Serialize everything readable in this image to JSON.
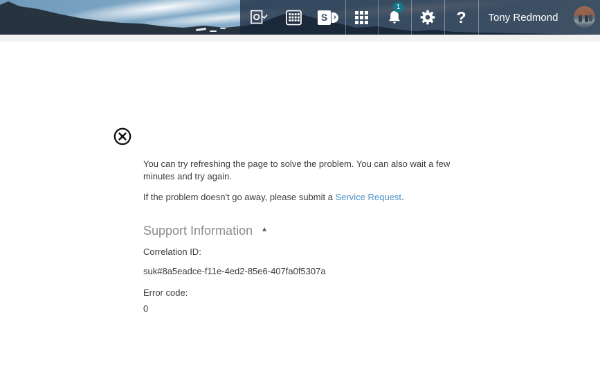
{
  "topbar": {
    "user_name": "Tony Redmond",
    "notification_badge": "1",
    "help_label": "?",
    "sharepoint_letter": "S",
    "sharepoint_arrow": "›"
  },
  "error_page": {
    "paragraph1": "You can try refreshing the page to solve the problem. You can also wait a few minutes and try again.",
    "paragraph2_prefix": "If the problem doesn't go away, please submit a ",
    "service_request_link": "Service Request",
    "paragraph2_suffix": ".",
    "support": {
      "heading": "Support Information",
      "collapse_arrow": "▲",
      "correlation_id_label": "Correlation ID:",
      "correlation_id_value": "suk#8a5eadce-f11e-4ed2-85e6-407fa0f5307a",
      "error_code_label": "Error code:",
      "error_code_value": "0"
    }
  },
  "colors": {
    "link_blue": "#4a90c9",
    "badge_teal": "#13798a",
    "topbar_overlay": "#2c3f55"
  }
}
